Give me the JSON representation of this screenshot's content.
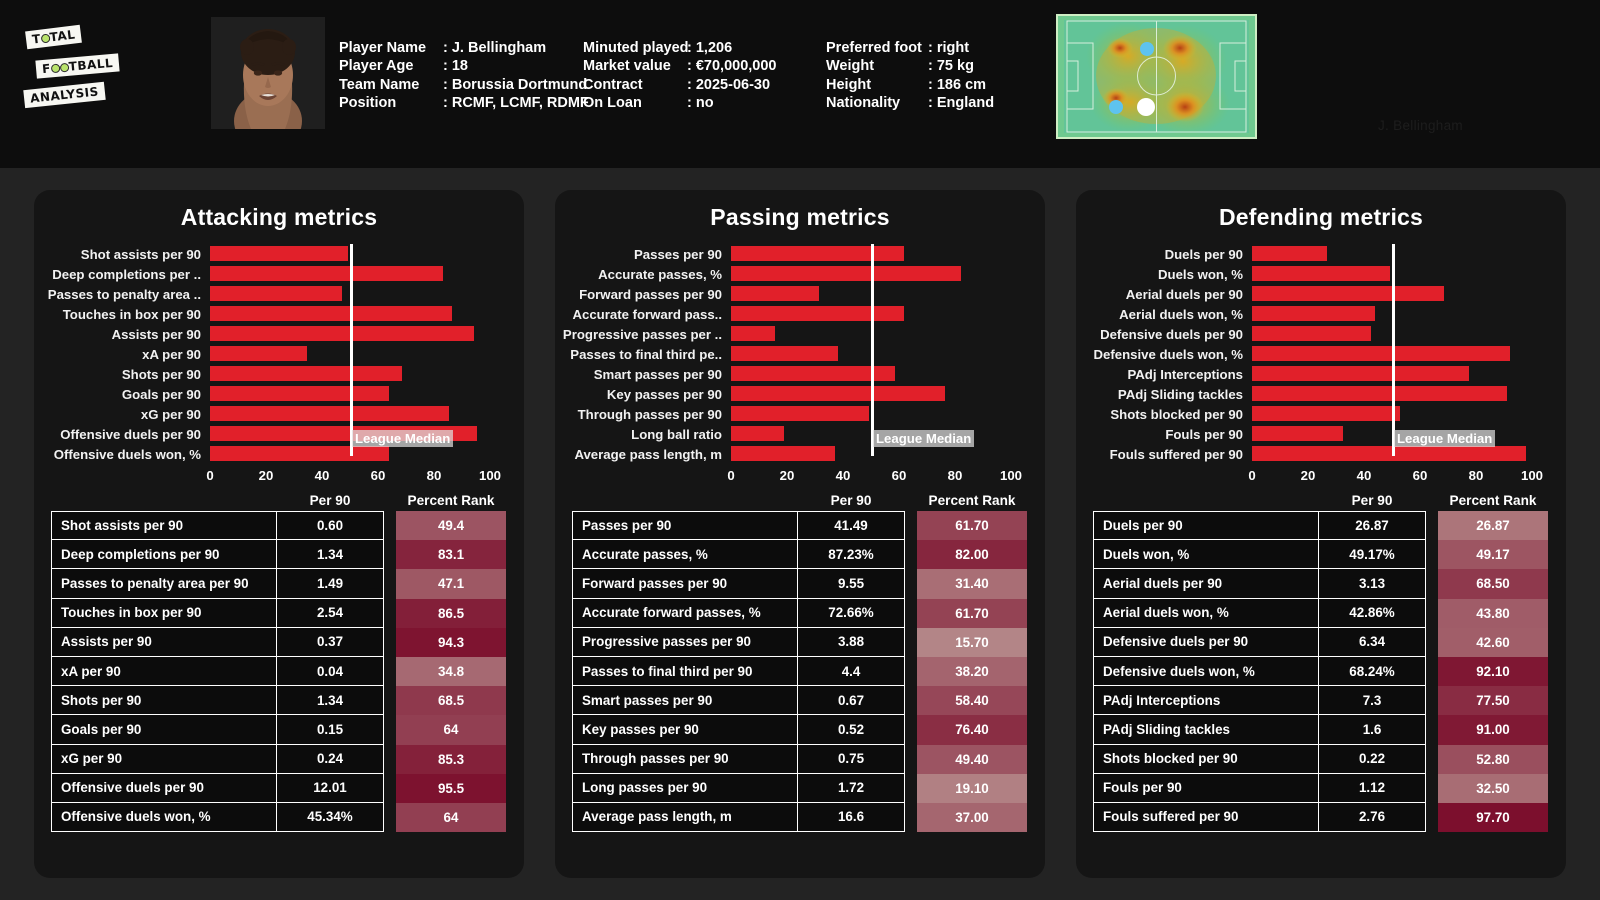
{
  "header": {
    "logo": {
      "line1": "T0TAL",
      "line2": "F00TBALL",
      "line3": "ANALYSIS",
      "ball_color": "#b9e36c"
    },
    "portrait_alt": "player-portrait",
    "watermark": "J. Bellingham",
    "info_columns": [
      [
        {
          "key": "Player Name",
          "value": ": J. Bellingham"
        },
        {
          "key": "Player Age",
          "value": ": 18"
        },
        {
          "key": "Team Name",
          "value": ": Borussia Dortmund"
        },
        {
          "key": "Position",
          "value": ": RCMF, LCMF, RDMF"
        }
      ],
      [
        {
          "key": "Minuted played",
          "value": ": 1,206"
        },
        {
          "key": "Market value",
          "value": ": €70,000,000"
        },
        {
          "key": "Contract",
          "value": ": 2025-06-30"
        },
        {
          "key": "On Loan",
          "value": ": no"
        }
      ],
      [
        {
          "key": "Preferred foot",
          "value": ": right"
        },
        {
          "key": "Weight",
          "value": ": 75 kg"
        },
        {
          "key": "Height",
          "value": ": 186 cm"
        },
        {
          "key": "Nationality",
          "value": ": England"
        }
      ]
    ]
  },
  "common": {
    "median_label": "League Median",
    "per90_header": "Per 90",
    "rank_header": "Percent Rank",
    "axis_ticks": [
      "0",
      "20",
      "40",
      "60",
      "80",
      "100"
    ],
    "bar_color": "#e1202a",
    "median_color": "#ffffff"
  },
  "chart_data": [
    {
      "type": "bar",
      "title": "Attacking metrics",
      "xlabel": "",
      "ylabel": "",
      "xlim": [
        0,
        100
      ],
      "grid": false,
      "median": 50,
      "median_label": "League Median",
      "categories": [
        "Shot assists per 90",
        "Deep completions per ..",
        "Passes to penalty area ..",
        "Touches in box per 90",
        "Assists per 90",
        "xA per 90",
        "Shots per 90",
        "Goals per 90",
        "xG per 90",
        "Offensive duels per 90",
        "Offensive duels won, %"
      ],
      "values": [
        49.4,
        83.1,
        47.1,
        86.5,
        94.3,
        34.8,
        68.5,
        64,
        85.3,
        95.5,
        64
      ],
      "table": {
        "columns": [
          "",
          "Per 90",
          "Percent Rank"
        ],
        "rows": [
          {
            "metric": "Shot assists per 90",
            "per90": "0.60",
            "rank": "49.4",
            "rank_value": 49.4
          },
          {
            "metric": "Deep completions per 90",
            "per90": "1.34",
            "rank": "83.1",
            "rank_value": 83.1
          },
          {
            "metric": "Passes to penalty area per 90",
            "per90": "1.49",
            "rank": "47.1",
            "rank_value": 47.1
          },
          {
            "metric": "Touches in box per 90",
            "per90": "2.54",
            "rank": "86.5",
            "rank_value": 86.5
          },
          {
            "metric": "Assists per 90",
            "per90": "0.37",
            "rank": "94.3",
            "rank_value": 94.3
          },
          {
            "metric": "xA per 90",
            "per90": "0.04",
            "rank": "34.8",
            "rank_value": 34.8
          },
          {
            "metric": "Shots per 90",
            "per90": "1.34",
            "rank": "68.5",
            "rank_value": 68.5
          },
          {
            "metric": "Goals per 90",
            "per90": "0.15",
            "rank": "64",
            "rank_value": 64
          },
          {
            "metric": "xG per 90",
            "per90": "0.24",
            "rank": "85.3",
            "rank_value": 85.3
          },
          {
            "metric": "Offensive duels per 90",
            "per90": "12.01",
            "rank": "95.5",
            "rank_value": 95.5
          },
          {
            "metric": "Offensive duels won, %",
            "per90": "45.34%",
            "rank": "64",
            "rank_value": 64
          }
        ]
      }
    },
    {
      "type": "bar",
      "title": "Passing metrics",
      "xlabel": "",
      "ylabel": "",
      "xlim": [
        0,
        100
      ],
      "grid": false,
      "median": 50,
      "median_label": "League Median",
      "categories": [
        "Passes per 90",
        "Accurate passes, %",
        "Forward passes per 90",
        "Accurate forward pass..",
        "Progressive passes per ..",
        "Passes to final third pe..",
        "Smart passes per 90",
        "Key passes per 90",
        "Through passes per 90",
        "Long ball ratio",
        "Average pass length, m"
      ],
      "values": [
        61.7,
        82.0,
        31.4,
        61.7,
        15.7,
        38.2,
        58.4,
        76.4,
        49.4,
        19.1,
        37.0
      ],
      "table": {
        "columns": [
          "",
          "Per 90",
          "Percent Rank"
        ],
        "rows": [
          {
            "metric": "Passes per 90",
            "per90": "41.49",
            "rank": "61.70",
            "rank_value": 61.7
          },
          {
            "metric": "Accurate passes, %",
            "per90": "87.23%",
            "rank": "82.00",
            "rank_value": 82.0
          },
          {
            "metric": "Forward passes per 90",
            "per90": "9.55",
            "rank": "31.40",
            "rank_value": 31.4
          },
          {
            "metric": "Accurate forward passes, %",
            "per90": "72.66%",
            "rank": "61.70",
            "rank_value": 61.7
          },
          {
            "metric": "Progressive passes per 90",
            "per90": "3.88",
            "rank": "15.70",
            "rank_value": 15.7
          },
          {
            "metric": "Passes to final third per 90",
            "per90": "4.4",
            "rank": "38.20",
            "rank_value": 38.2
          },
          {
            "metric": "Smart passes per 90",
            "per90": "0.67",
            "rank": "58.40",
            "rank_value": 58.4
          },
          {
            "metric": "Key passes per 90",
            "per90": "0.52",
            "rank": "76.40",
            "rank_value": 76.4
          },
          {
            "metric": "Through passes per 90",
            "per90": "0.75",
            "rank": "49.40",
            "rank_value": 49.4
          },
          {
            "metric": "Long passes per 90",
            "per90": "1.72",
            "rank": "19.10",
            "rank_value": 19.1
          },
          {
            "metric": "Average pass length, m",
            "per90": "16.6",
            "rank": "37.00",
            "rank_value": 37.0
          }
        ]
      }
    },
    {
      "type": "bar",
      "title": "Defending metrics",
      "xlabel": "",
      "ylabel": "",
      "xlim": [
        0,
        100
      ],
      "grid": false,
      "median": 50,
      "median_label": "League Median",
      "categories": [
        "Duels per 90",
        "Duels won, %",
        "Aerial duels per 90",
        "Aerial duels won, %",
        "Defensive duels per 90",
        "Defensive duels won, %",
        "PAdj Interceptions",
        "PAdj Sliding tackles",
        "Shots blocked per 90",
        "Fouls per 90",
        "Fouls suffered per 90"
      ],
      "values": [
        26.87,
        49.17,
        68.5,
        43.8,
        42.6,
        92.1,
        77.5,
        91.0,
        52.8,
        32.5,
        97.7
      ],
      "table": {
        "columns": [
          "",
          "Per 90",
          "Percent Rank"
        ],
        "rows": [
          {
            "metric": "Duels per 90",
            "per90": "26.87",
            "rank": "26.87",
            "rank_value": 26.87
          },
          {
            "metric": "Duels won, %",
            "per90": "49.17%",
            "rank": "49.17",
            "rank_value": 49.17
          },
          {
            "metric": "Aerial duels per 90",
            "per90": "3.13",
            "rank": "68.50",
            "rank_value": 68.5
          },
          {
            "metric": "Aerial duels won, %",
            "per90": "42.86%",
            "rank": "43.80",
            "rank_value": 43.8
          },
          {
            "metric": "Defensive duels per 90",
            "per90": "6.34",
            "rank": "42.60",
            "rank_value": 42.6
          },
          {
            "metric": "Defensive duels won, %",
            "per90": "68.24%",
            "rank": "92.10",
            "rank_value": 92.1
          },
          {
            "metric": "PAdj Interceptions",
            "per90": "7.3",
            "rank": "77.50",
            "rank_value": 77.5
          },
          {
            "metric": "PAdj Sliding tackles",
            "per90": "1.6",
            "rank": "91.00",
            "rank_value": 91.0
          },
          {
            "metric": "Shots blocked per 90",
            "per90": "0.22",
            "rank": "52.80",
            "rank_value": 52.8
          },
          {
            "metric": "Fouls per 90",
            "per90": "1.12",
            "rank": "32.50",
            "rank_value": 32.5
          },
          {
            "metric": "Fouls suffered per 90",
            "per90": "2.76",
            "rank": "97.70",
            "rank_value": 97.7
          }
        ]
      }
    }
  ]
}
